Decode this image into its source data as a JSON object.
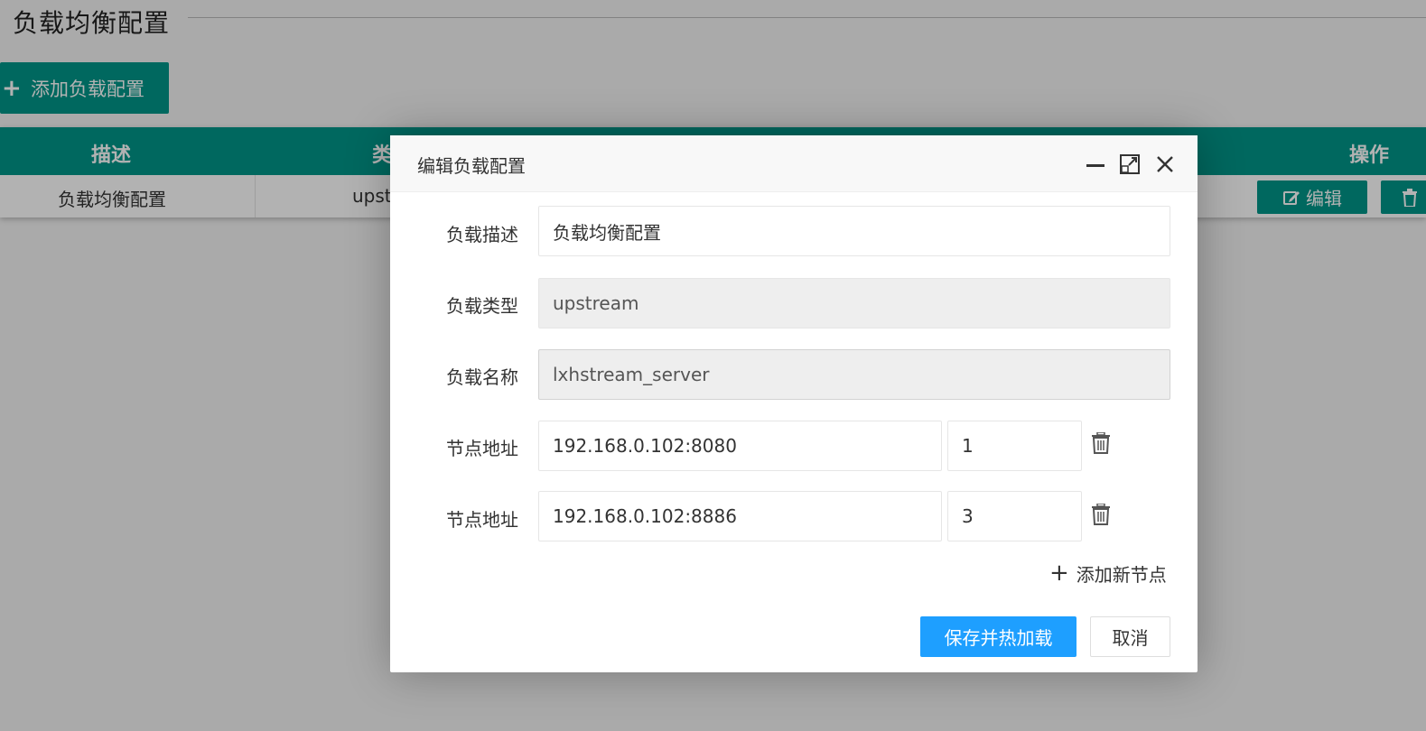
{
  "page": {
    "title": "负载均衡配置",
    "add_button_label": "添加负载配置"
  },
  "table": {
    "columns": {
      "desc": "描述",
      "type": "类",
      "ops": "操作"
    },
    "rows": [
      {
        "desc": "负载均衡配置",
        "type": "upst",
        "edit_label": "编辑"
      }
    ]
  },
  "dialog": {
    "title": "编辑负载配置",
    "fields": {
      "desc_label": "负载描述",
      "desc_value": "负载均衡配置",
      "type_label": "负载类型",
      "type_value": "upstream",
      "name_label": "负载名称",
      "name_value": "lxhstream_server"
    },
    "nodes": [
      {
        "label": "节点地址",
        "address": "192.168.0.102:8080",
        "weight": "1"
      },
      {
        "label": "节点地址",
        "address": "192.168.0.102:8886",
        "weight": "3"
      }
    ],
    "add_node_label": "添加新节点",
    "save_label": "保存并热加载",
    "cancel_label": "取消"
  },
  "colors": {
    "primary_teal": "#009688",
    "primary_blue": "#1e9fff",
    "overlay": "rgba(0,0,0,0.3)"
  },
  "icons": [
    "plus-icon",
    "edit-icon",
    "trash-icon",
    "minimize-icon",
    "maximize-icon",
    "close-icon"
  ]
}
